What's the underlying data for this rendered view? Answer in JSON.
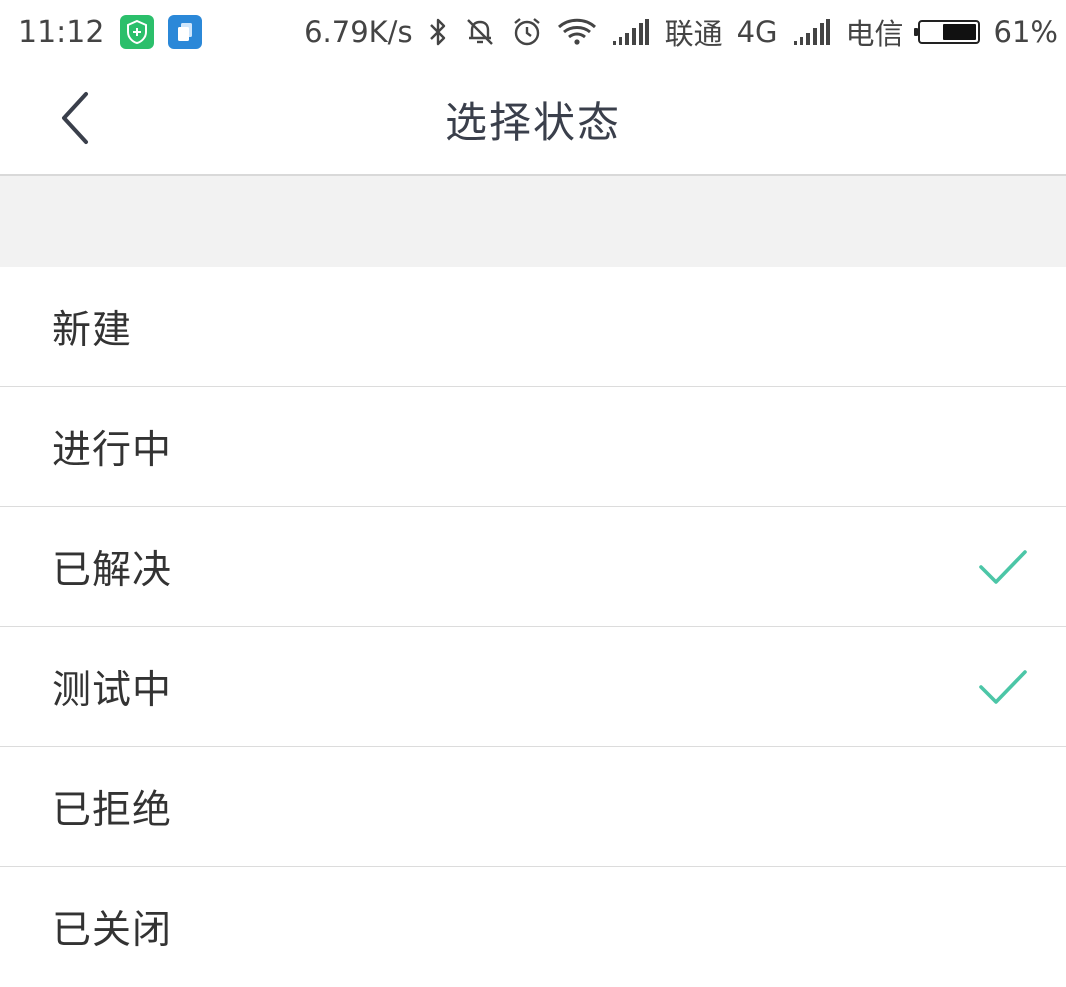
{
  "status_bar": {
    "time": "11:12",
    "network_speed": "6.79K/s",
    "carrier_1": "联通",
    "network_type": "4G",
    "carrier_2": "电信",
    "battery_percent": "61%",
    "battery_level": 0.61,
    "icons": [
      "shield-app-icon",
      "files-app-icon",
      "bluetooth-icon",
      "mute-icon",
      "alarm-icon",
      "wifi-icon",
      "signal-icon",
      "signal-icon"
    ]
  },
  "nav": {
    "title": "选择状态",
    "back_icon": "chevron-left-icon"
  },
  "status_list": [
    {
      "label": "新建",
      "checked": false
    },
    {
      "label": "进行中",
      "checked": false
    },
    {
      "label": "已解决",
      "checked": true
    },
    {
      "label": "测试中",
      "checked": true
    },
    {
      "label": "已拒绝",
      "checked": false
    },
    {
      "label": "已关闭",
      "checked": false
    }
  ],
  "colors": {
    "check": "#4cc6a7",
    "text": "#333333",
    "title": "#3a3f4b",
    "divider": "#dcdcdc",
    "gap": "#f2f2f2"
  }
}
